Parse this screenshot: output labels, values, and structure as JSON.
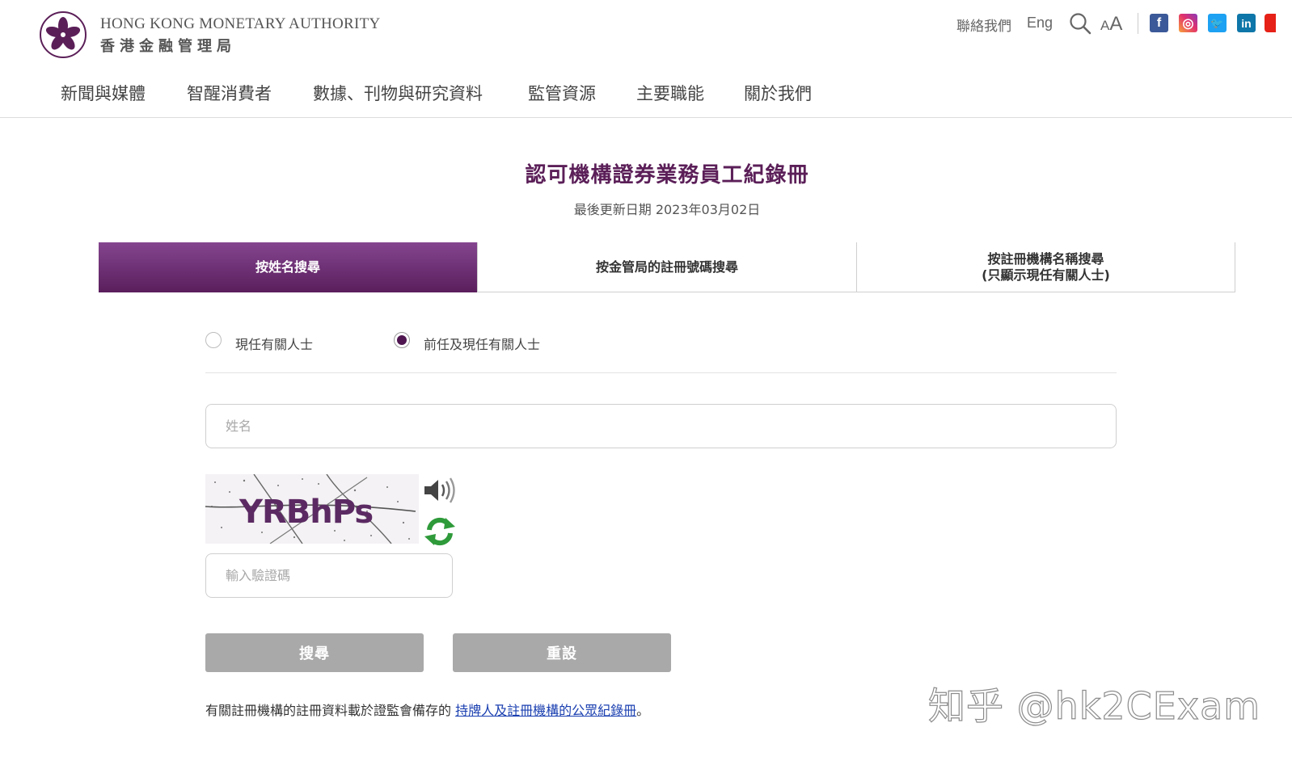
{
  "header": {
    "logo_en": "HONG KONG MONETARY AUTHORITY",
    "logo_zh": "香港金融管理局",
    "contact_label": "聯絡我們",
    "lang_label": "Eng",
    "font_size_small": "A",
    "font_size_big": "A",
    "social": {
      "facebook": "f",
      "instagram": "◎",
      "twitter": "🐦",
      "linkedin": "in"
    }
  },
  "nav": {
    "items": [
      {
        "label": "新聞與媒體"
      },
      {
        "label": "智醒消費者"
      },
      {
        "label": "數據、刊物與研究資料"
      },
      {
        "label": "監管資源"
      },
      {
        "label": "主要職能"
      },
      {
        "label": "關於我們"
      }
    ]
  },
  "page": {
    "title": "認可機構證券業務員工紀錄冊",
    "last_updated": "最後更新日期 2023年03月02日"
  },
  "tabs": [
    {
      "label": "按姓名搜尋",
      "active": true
    },
    {
      "label": "按金管局的註冊號碼搜尋",
      "active": false
    },
    {
      "label_line1": "按註冊機構名稱搜尋",
      "label_line2": "(只顯示現任有關人士)",
      "active": false
    }
  ],
  "form": {
    "radio_options": [
      {
        "label": "現任有關人士",
        "checked": false
      },
      {
        "label": "前任及現任有關人士",
        "checked": true
      }
    ],
    "name_placeholder": "姓名",
    "captcha_text": "YRBhPs",
    "captcha_placeholder": "輸入驗證碼",
    "search_button": "搜尋",
    "reset_button": "重設"
  },
  "footnote": {
    "prefix": "有關註冊機構的註冊資料載於證監會備存的 ",
    "link": "持牌人及註冊機構的公眾紀錄冊",
    "suffix": "。"
  },
  "watermark": "知乎 @hk2CExam",
  "colors": {
    "brand_purple": "#5b1f58",
    "button_disabled": "#a9a9a9",
    "link": "#1a3fb0"
  }
}
